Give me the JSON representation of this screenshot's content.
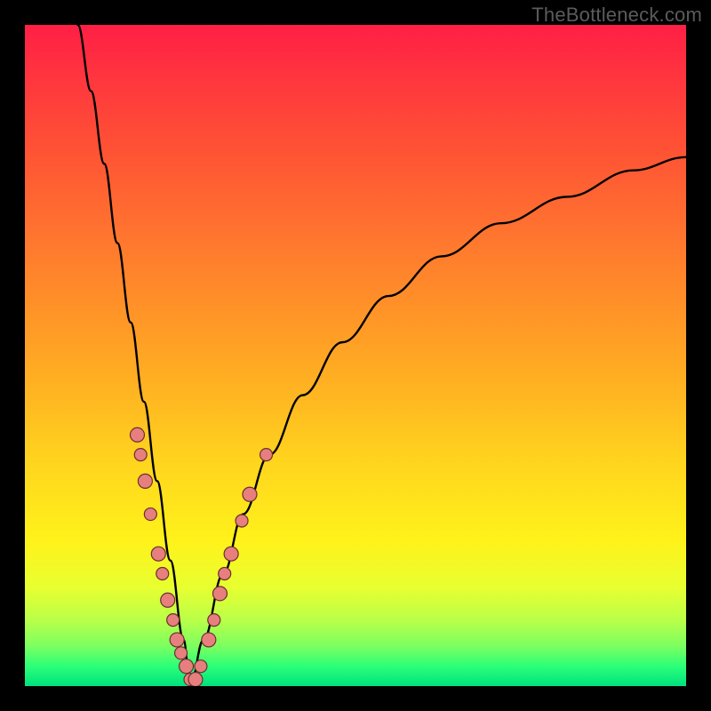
{
  "watermark": "TheBottleneck.com",
  "colors": {
    "background": "#000000",
    "dot_fill": "#e77f7f",
    "dot_stroke": "#6b2f2f",
    "curve": "#000000"
  },
  "chart_data": {
    "type": "line",
    "title": "",
    "xlabel": "",
    "ylabel": "",
    "xlim": [
      0,
      100
    ],
    "ylim": [
      0,
      100
    ],
    "curve_description": "Two smooth black curves form a sharp V / notch on a vertical rainbow gradient. Left branch descends steeply from top-left to a minimum near x≈25, y≈0. Right branch rises from the minimum with decreasing slope toward top-right, ending near y≈80 at x=100.",
    "series": [
      {
        "name": "left_branch",
        "x": [
          8,
          10,
          12,
          14,
          16,
          18,
          20,
          22,
          24,
          25
        ],
        "y": [
          100,
          90,
          79,
          67,
          55,
          43,
          31,
          19,
          7,
          0
        ]
      },
      {
        "name": "right_branch",
        "x": [
          25,
          27,
          30,
          33,
          37,
          42,
          48,
          55,
          63,
          72,
          82,
          92,
          100
        ],
        "y": [
          0,
          7,
          17,
          26,
          35,
          44,
          52,
          59,
          65,
          70,
          74,
          78,
          80
        ]
      }
    ],
    "dots_description": "Salmon-pink circular markers clustered along both branches near the bottom of the V, roughly in the y-range 0 to 35.",
    "dots": [
      {
        "x": 17.0,
        "y": 38,
        "r": 8
      },
      {
        "x": 17.5,
        "y": 35,
        "r": 7
      },
      {
        "x": 18.2,
        "y": 31,
        "r": 8
      },
      {
        "x": 19.0,
        "y": 26,
        "r": 7
      },
      {
        "x": 20.2,
        "y": 20,
        "r": 8
      },
      {
        "x": 20.8,
        "y": 17,
        "r": 7
      },
      {
        "x": 21.6,
        "y": 13,
        "r": 8
      },
      {
        "x": 22.4,
        "y": 10,
        "r": 7
      },
      {
        "x": 23.0,
        "y": 7,
        "r": 8
      },
      {
        "x": 23.6,
        "y": 5,
        "r": 7
      },
      {
        "x": 24.4,
        "y": 3,
        "r": 8
      },
      {
        "x": 25.0,
        "y": 1,
        "r": 7
      },
      {
        "x": 25.8,
        "y": 1,
        "r": 8
      },
      {
        "x": 26.6,
        "y": 3,
        "r": 7
      },
      {
        "x": 27.8,
        "y": 7,
        "r": 8
      },
      {
        "x": 28.6,
        "y": 10,
        "r": 7
      },
      {
        "x": 29.5,
        "y": 14,
        "r": 8
      },
      {
        "x": 30.2,
        "y": 17,
        "r": 7
      },
      {
        "x": 31.2,
        "y": 20,
        "r": 8
      },
      {
        "x": 32.8,
        "y": 25,
        "r": 7
      },
      {
        "x": 34.0,
        "y": 29,
        "r": 8
      },
      {
        "x": 36.5,
        "y": 35,
        "r": 7
      }
    ]
  }
}
